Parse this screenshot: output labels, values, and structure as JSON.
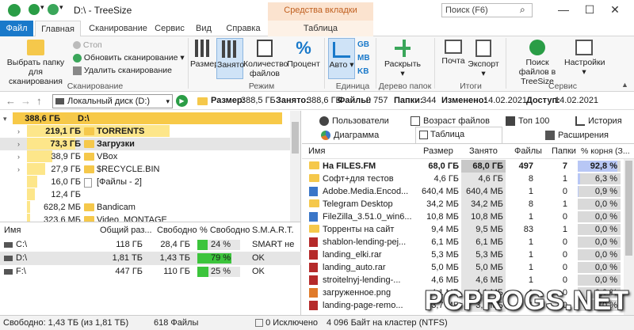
{
  "window": {
    "title": "D:\\ - TreeSize",
    "context_tab_header": "Средства вкладки \"Таблица\"",
    "search_placeholder": "Поиск (F6)"
  },
  "ribbon_tabs": [
    "Файл",
    "Главная",
    "Сканирование",
    "Сервис",
    "Вид",
    "Справка",
    "Таблица"
  ],
  "ribbon": {
    "scan_select": "Выбрать папку для сканирования",
    "stop": "Стоп",
    "refresh": "Обновить сканирование",
    "delete_scan": "Удалить сканирование",
    "group_scan": "Сканирование",
    "size": "Размер",
    "occupied": "Занято",
    "file_count": "Количество файлов",
    "percent": "Процент",
    "group_mode": "Режим",
    "auto": "Авто",
    "unit_gb": "GB",
    "unit_mb": "MB",
    "unit_kb": "KB",
    "group_unit": "Единица",
    "expand": "Раскрыть",
    "group_tree": "Дерево папок",
    "mail": "Почта",
    "export": "Экспорт",
    "group_results": "Итоги сканирования",
    "search_files": "Поиск файлов в TreeSize",
    "settings": "Настройки",
    "group_service": "Сервис"
  },
  "address": {
    "drive": "Локальный диск (D:)",
    "size_label": "Размер:",
    "size_value": "388,5 ГБ",
    "occupied_label": "Занято:",
    "occupied_value": "388,6 ГБ",
    "files_label": "Файлы:",
    "files_value": "9 757",
    "folders_label": "Папки:",
    "folders_value": "344",
    "changed_label": "Изменено:",
    "changed_value": "14.02.2021",
    "access_label": "Доступ:",
    "access_value": "14.02.2021"
  },
  "tree": [
    {
      "size": "388,6 ГБ",
      "name": "D:\\",
      "fill": 1.0
    },
    {
      "size": "219,1 ГБ",
      "name": "TORRENTS",
      "fill": 0.56
    },
    {
      "size": "73,3 ГБ",
      "name": "Загрузки",
      "fill": 0.19
    },
    {
      "size": "38,9 ГБ",
      "name": "VBox",
      "fill": 0.1
    },
    {
      "size": "27,9 ГБ",
      "name": "$RECYCLE.BIN",
      "fill": 0.07
    },
    {
      "size": "16,0 ГБ",
      "name": "[Файлы - 2]",
      "fill": 0.04
    },
    {
      "size": "12,4 ГБ",
      "name": "",
      "fill": 0.03
    },
    {
      "size": "628,2 МБ",
      "name": "Bandicam",
      "fill": 0.01
    },
    {
      "size": "323,6 МБ",
      "name": "Video_MONTAGE",
      "fill": 0.01
    }
  ],
  "drives": {
    "headers": [
      "Имя",
      "Общий раз...",
      "Свободно",
      "% Свободно",
      "S.M.A.R.T."
    ],
    "rows": [
      {
        "name": "C:\\",
        "total": "118 ГБ",
        "free": "28,4 ГБ",
        "pct": "24 %",
        "pct_value": 24,
        "smart": "SMART не ..."
      },
      {
        "name": "D:\\",
        "total": "1,81 ТБ",
        "free": "1,43 ТБ",
        "pct": "79 %",
        "pct_value": 79,
        "smart": "OK"
      },
      {
        "name": "F:\\",
        "total": "447 ГБ",
        "free": "110 ГБ",
        "pct": "25 %",
        "pct_value": 25,
        "smart": "OK"
      }
    ]
  },
  "right_tabs": {
    "row1": [
      "Пользователи",
      "Возраст файлов",
      "Топ 100",
      "История"
    ],
    "row2": [
      "Диаграмма",
      "Таблица",
      "Расширения"
    ]
  },
  "table": {
    "headers": [
      "Имя",
      "Размер",
      "Занято",
      "Файлы",
      "Папки",
      "% корня (З..."
    ],
    "rows": [
      {
        "icon": "folder",
        "name": "На FILES.FM",
        "size": "68,0 ГБ",
        "occ": "68,0 ГБ",
        "files": "497",
        "folders": "7",
        "pct": "92,8 %",
        "pct_value": 92.8
      },
      {
        "icon": "folder",
        "name": "Софт+для тестов",
        "size": "4,6 ГБ",
        "occ": "4,6 ГБ",
        "files": "8",
        "folders": "1",
        "pct": "6,3 %",
        "pct_value": 6.3
      },
      {
        "icon": "exe",
        "name": "Adobe.Media.Encod...",
        "size": "640,4 МБ",
        "occ": "640,4 МБ",
        "files": "1",
        "folders": "0",
        "pct": "0,9 %",
        "pct_value": 0.9
      },
      {
        "icon": "folder",
        "name": "Telegram Desktop",
        "size": "34,2 МБ",
        "occ": "34,2 МБ",
        "files": "8",
        "folders": "1",
        "pct": "0,0 %",
        "pct_value": 0
      },
      {
        "icon": "exe",
        "name": "FileZilla_3.51.0_win6...",
        "size": "10,8 МБ",
        "occ": "10,8 МБ",
        "files": "1",
        "folders": "0",
        "pct": "0,0 %",
        "pct_value": 0
      },
      {
        "icon": "folder",
        "name": "Торренты на сайт",
        "size": "9,4 МБ",
        "occ": "9,5 МБ",
        "files": "83",
        "folders": "1",
        "pct": "0,0 %",
        "pct_value": 0
      },
      {
        "icon": "zip",
        "name": "shablon-lending-pej...",
        "size": "6,1 МБ",
        "occ": "6,1 МБ",
        "files": "1",
        "folders": "0",
        "pct": "0,0 %",
        "pct_value": 0
      },
      {
        "icon": "zip",
        "name": "landing_elki.rar",
        "size": "5,3 МБ",
        "occ": "5,3 МБ",
        "files": "1",
        "folders": "0",
        "pct": "0,0 %",
        "pct_value": 0
      },
      {
        "icon": "zip",
        "name": "landing_auto.rar",
        "size": "5,0 МБ",
        "occ": "5,0 МБ",
        "files": "1",
        "folders": "0",
        "pct": "0,0 %",
        "pct_value": 0
      },
      {
        "icon": "zip",
        "name": "stroitelnyj-lending-...",
        "size": "4,6 МБ",
        "occ": "4,6 МБ",
        "files": "1",
        "folders": "0",
        "pct": "0,0 %",
        "pct_value": 0
      },
      {
        "icon": "img",
        "name": "загруженное.png",
        "size": "4,1 МБ",
        "occ": "4,1 МБ",
        "files": "1",
        "folders": "0",
        "pct": "0,0 %",
        "pct_value": 0
      },
      {
        "icon": "zip",
        "name": "landing-page-remo...",
        "size": "3,7 МБ",
        "occ": "3,7 МБ",
        "files": "1",
        "folders": "0",
        "pct": "0,0 %",
        "pct_value": 0
      }
    ]
  },
  "status": {
    "free": "Свободно: 1,43 ТБ  (из 1,81 ТБ)",
    "files": "618 Файлы",
    "excluded": "0 Исключено",
    "cluster": "4 096 Байт на кластер (NTFS)"
  },
  "watermark": "PCPROGS.NET",
  "colors": {
    "accent": "#1979ca",
    "tree_bar": "#fde68a",
    "tree_bar_selected": "#f7c948",
    "free_green": "#3cc43c",
    "pct_blue": "#b8c7f5"
  }
}
